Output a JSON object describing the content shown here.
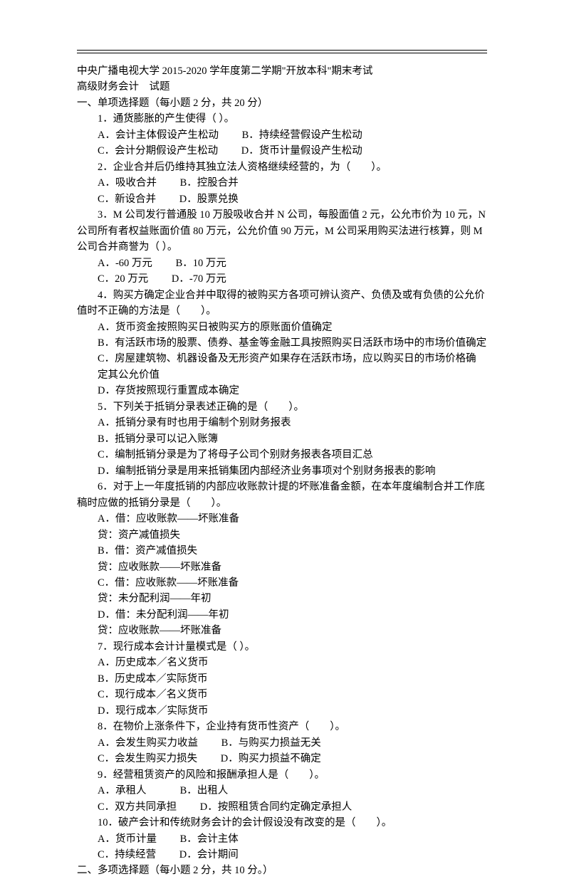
{
  "header": {
    "title": "中央广播电视大学 2015-2020 学年度第二学期\"开放本科\"期末考试",
    "subtitle": "高级财务会计　试题"
  },
  "section1": {
    "heading": "一、单项选择题（每小题 2 分，共 20 分）",
    "q1": {
      "stem": "1．通货膨胀的产生使得（ ）。",
      "a": "A．会计主体假设产生松动",
      "b": "B．持续经营假设产生松动",
      "c": "C．会计分期假设产生松动",
      "d": "D．货币计量假设产生松动"
    },
    "q2": {
      "stem": "2．企业合并后仍维持其独立法人资格继续经营的，为（　　）。",
      "a": "A．吸收合并",
      "b": "B．控股合并",
      "c": "C．新设合并",
      "d": "D．股票兑换"
    },
    "q3": {
      "line1": "3．M 公司发行普通股 10 万股吸收合并 N 公司，每股面值 2 元，公允市价为 10 元，N",
      "line2": "公司所有者权益账面价值 80 万元，公允价值 90 万元，M 公司采用购买法进行核算，则 M",
      "line3": "公司合并商誉为（ ）。",
      "a": "A．-60 万元",
      "b": "B．10 万元",
      "c": "C．20 万元",
      "d": "D．-70 万元"
    },
    "q4": {
      "line1": "4．购买方确定企业合并中取得的被购买方各项可辨认资产、负债及或有负债的公允价",
      "line2": "值时不正确的方法是（　　）。",
      "a": "A．货币资金按照购买日被购买方的原账面价值确定",
      "b": "B．有活跃市场的股票、债券、基金等金融工具按照购买日活跃市场中的市场价值确定",
      "c1": "C．房屋建筑物、机器设备及无形资产如果存在活跃市场，应以购买日的市场价格确",
      "c2": "定其公允价值",
      "d": "D．存货按照现行重置成本确定"
    },
    "q5": {
      "stem": "5．下列关于抵销分录表述正确的是（　　）。",
      "a": "A．抵销分录有时也用于编制个别财务报表",
      "b": "B．抵销分录可以记入账簿",
      "c": "C．编制抵销分录是为了将母子公司个别财务报表各项目汇总",
      "d": "D．编制抵销分录是用来抵销集团内部经济业务事项对个别财务报表的影响"
    },
    "q6": {
      "line1": "6．对于上一年度抵销的内部应收账款计提的坏账准备金额，在本年度编制合并工作底",
      "line2": "稿时应做的抵销分录是（　　）。",
      "a1": "A．借：应收账款——坏账准备",
      "a2": "贷：资产减值损失",
      "b1": "B．借：资产减值损失",
      "b2": "贷：应收账款——坏账准备",
      "c1": "C．借：应收账款——坏账准备",
      "c2": "贷：未分配利润——年初",
      "d1": "D．借：未分配利润——年初",
      "d2": "贷：应收账款——坏账准备"
    },
    "q7": {
      "stem": "7．现行成本会计计量模式是（ ）。",
      "a": "A．历史成本／名义货币",
      "b": "B．历史成本／实际货币",
      "c": "C．现行成本／名义货币",
      "d": "D．现行成本／实际货币"
    },
    "q8": {
      "stem": "8．在物价上涨条件下，企业持有货币性资产（　　）。",
      "a": "A．会发生购买力收益",
      "b": "B．与购买力损益无关",
      "c": "C．会发生购买力损失",
      "d": "D．购买力损益不确定"
    },
    "q9": {
      "stem": "9．经营租赁资产的风险和报酬承担人是（　　）。",
      "a": "A．承租人",
      "b": "B．出租人",
      "c": "C．双方共同承担",
      "d": "D．按照租赁合同约定确定承担人"
    },
    "q10": {
      "stem": "10．破产会计和传统财务会计的会计假设没有改变的是（　　）。",
      "a": "A．货币计量",
      "b": "B．会计主体",
      "c": "C．持续经营",
      "d": "D．会计期间"
    }
  },
  "section2": {
    "heading": "二、多项选择题（每小题 2 分，共 10 分。）"
  }
}
